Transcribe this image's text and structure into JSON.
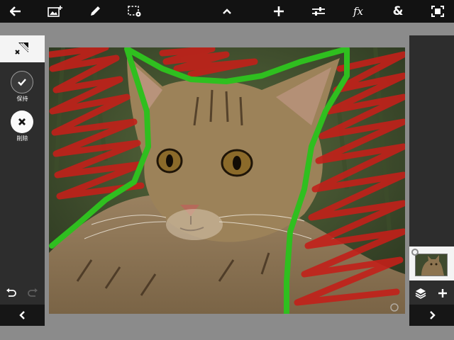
{
  "toolbar": {
    "icons": [
      "back-arrow-icon",
      "add-image-icon",
      "pencil-icon",
      "selection-settings-icon",
      "chevron-up-icon",
      "plus-icon",
      "sliders-icon",
      "fx-icon",
      "ampersand-icon",
      "fullscreen-icon"
    ],
    "fx_label": "fx",
    "amp_label": "&"
  },
  "left_panel": {
    "tool_icon": "refine-selection-icon",
    "keep_label": "保持",
    "delete_label": "削除",
    "undo_icon": "undo-icon",
    "redo_icon": "redo-icon",
    "collapse_icon": "chevron-left-icon"
  },
  "right_panel": {
    "layers_icon": "layers-icon",
    "add_layer_icon": "plus-icon",
    "expand_icon": "chevron-right-icon"
  },
  "colors": {
    "toolbar_bg": "#121212",
    "panel_bg": "#2d2d2d",
    "workspace_bg": "#8b8b8b",
    "keep_stroke": "#2fbf1f",
    "remove_stroke": "#c2201a"
  }
}
